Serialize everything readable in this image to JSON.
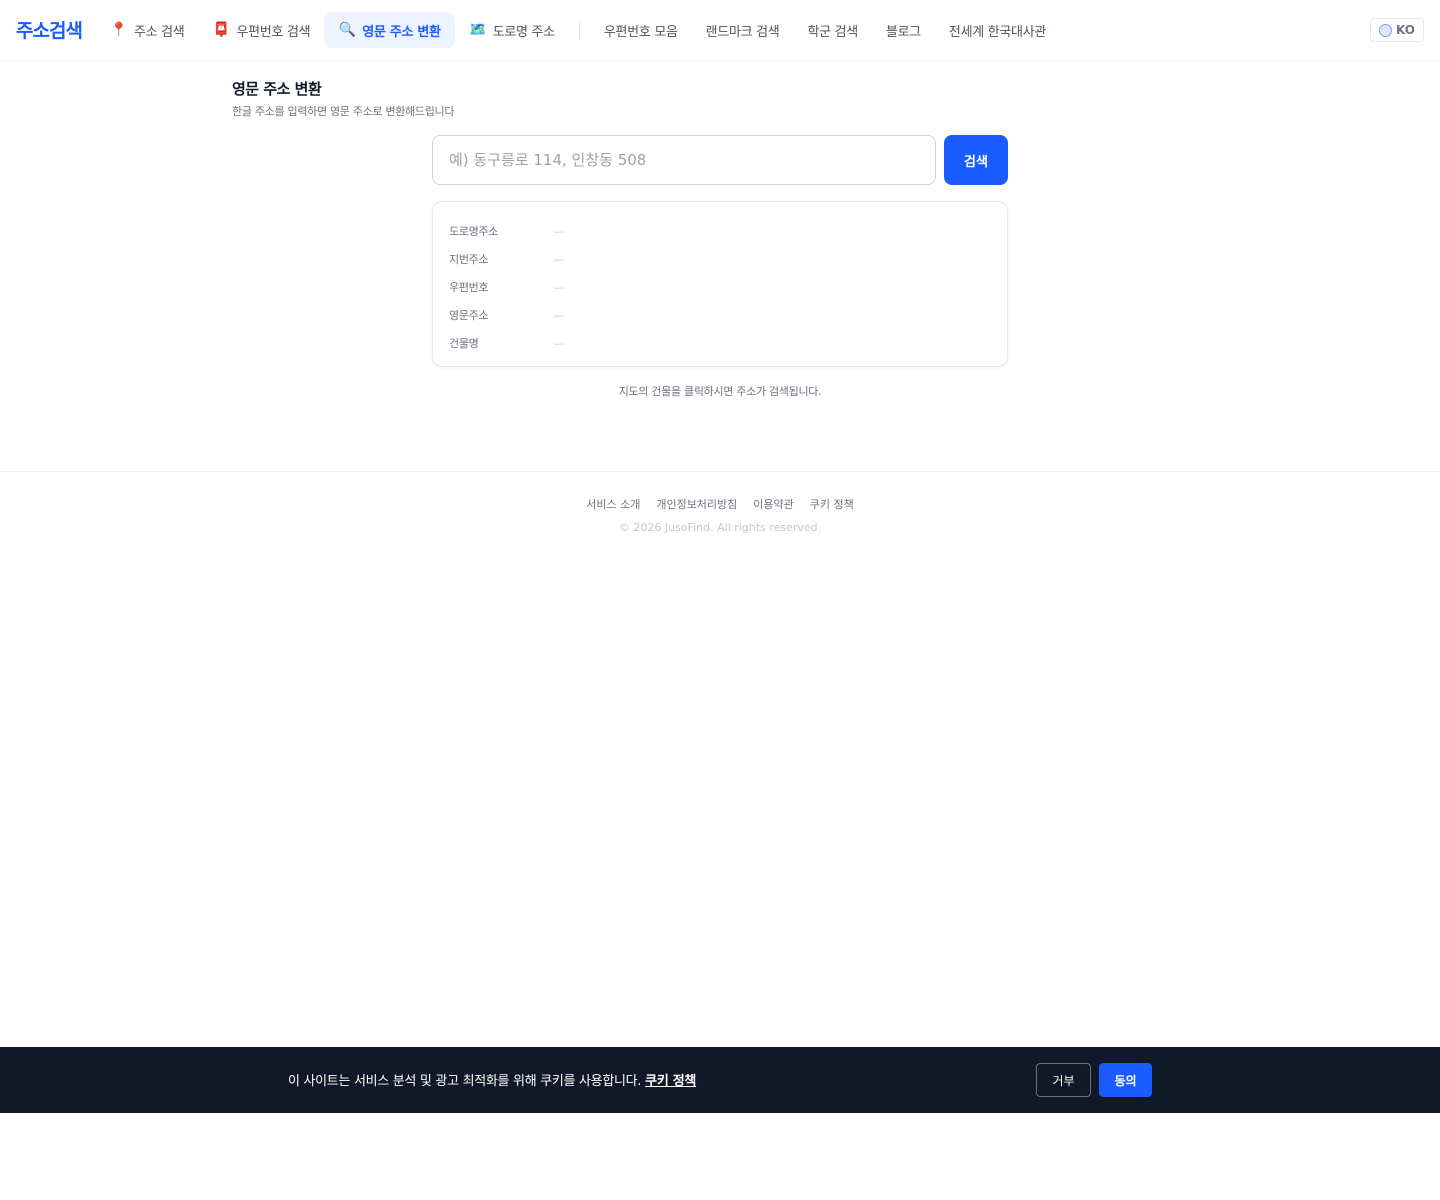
{
  "header": {
    "logo": "주소검색",
    "nav": [
      {
        "icon": "map-pin-icon",
        "glyph": "📍",
        "label": "주소 검색"
      },
      {
        "icon": "postbox-icon",
        "glyph": "📮",
        "label": "우편번호 검색"
      },
      {
        "icon": "magnifier-icon",
        "glyph": "🔍",
        "label": "영문 주소 변환"
      },
      {
        "icon": "map-icon",
        "glyph": "🗺️",
        "label": "도로명 주소"
      }
    ],
    "links": [
      "우편번호 모음",
      "랜드마크 검색",
      "학군 검색",
      "블로그",
      "전세계 한국대사관"
    ],
    "language": "KO"
  },
  "page": {
    "title": "영문 주소 변환",
    "subtitle": "한글 주소를 입력하면 영문 주소로 변환해드립니다"
  },
  "search": {
    "placeholder": "예) 동구릉로 114, 인창동 508",
    "button": "검색"
  },
  "result": {
    "rows": [
      {
        "label": "도로명주소",
        "value": "—"
      },
      {
        "label": "지번주소",
        "value": "—"
      },
      {
        "label": "우편번호",
        "value": "—"
      },
      {
        "label": "영문주소",
        "value": "—"
      },
      {
        "label": "건물명",
        "value": "—"
      }
    ]
  },
  "map_hint": "지도의 건물을 클릭하시면 주소가 검색됩니다.",
  "footer": {
    "links": [
      "서비스 소개",
      "개인정보처리방침",
      "이용약관",
      "쿠키 정책"
    ],
    "copyright": "© 2026 JusoFind. All rights reserved."
  },
  "cookie": {
    "message": "이 사이트는 서비스 분석 및 광고 최적화를 위해 쿠키를 사용합니다.",
    "link": "쿠키 정책",
    "reject": "거부",
    "accept": "동의"
  },
  "colors": {
    "accent": "#1a5cff",
    "banner_bg": "#111827",
    "active_nav_bg": "#eef4ff"
  }
}
